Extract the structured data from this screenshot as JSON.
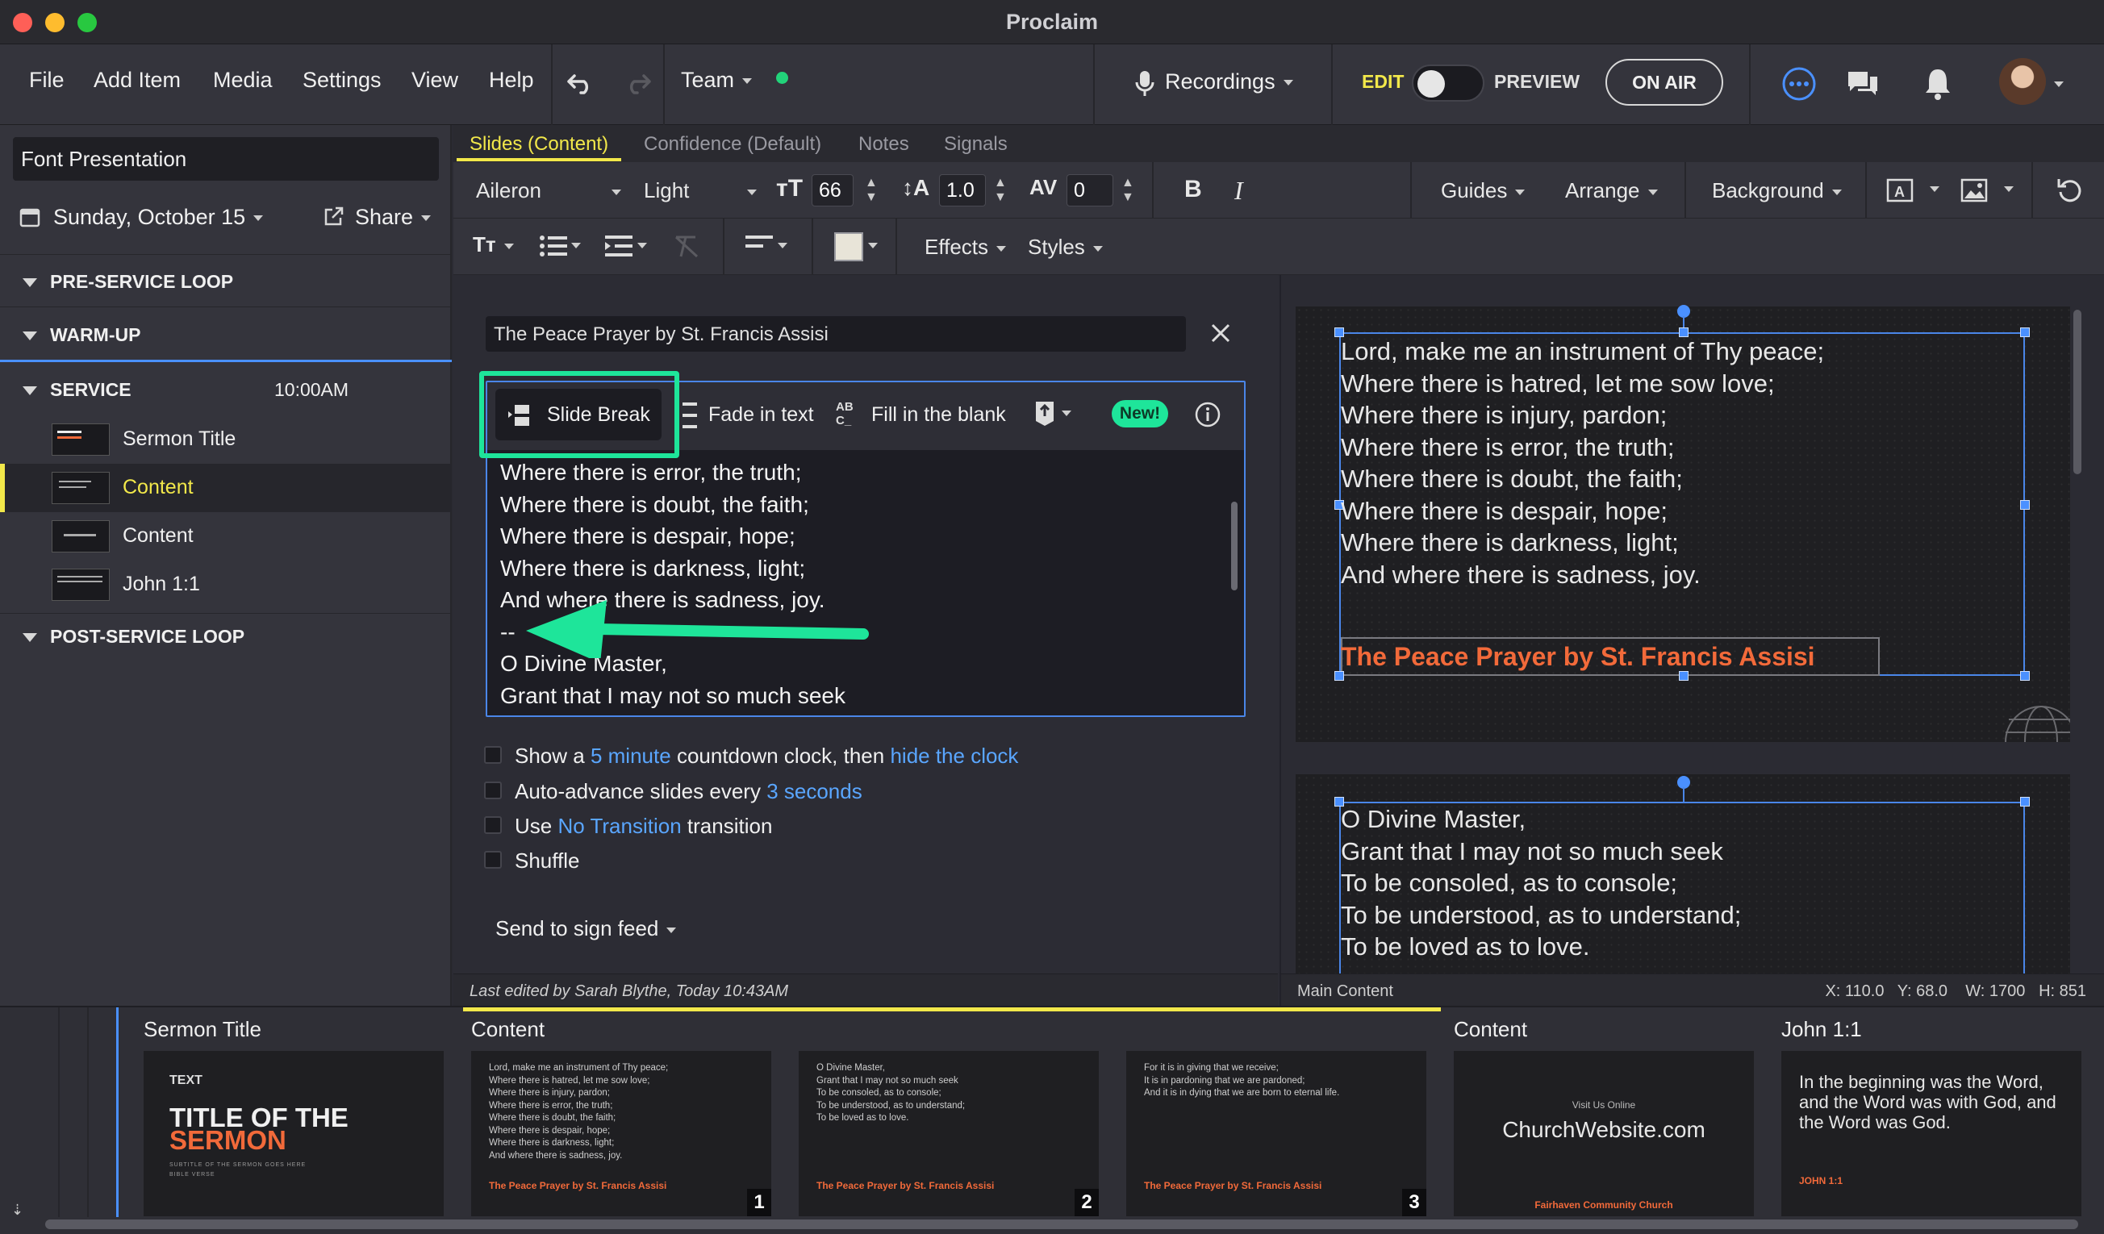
{
  "app": {
    "title": "Proclaim"
  },
  "menu": {
    "file": "File",
    "add_item": "Add Item",
    "media": "Media",
    "settings": "Settings",
    "view": "View",
    "help": "Help",
    "team": "Team",
    "recordings": "Recordings",
    "edit": "EDIT",
    "preview": "PREVIEW",
    "on_air": "ON AIR"
  },
  "sidebar": {
    "presentation": "Font Presentation",
    "date": "Sunday, October 15",
    "share": "Share",
    "sections": {
      "pre": "PRE-SERVICE LOOP",
      "warm": "WARM-UP",
      "service": "SERVICE",
      "service_time": "10:00AM",
      "post": "POST-SERVICE LOOP"
    },
    "items": [
      {
        "label": "Sermon Title"
      },
      {
        "label": "Content"
      },
      {
        "label": "Content"
      },
      {
        "label": "John 1:1"
      }
    ]
  },
  "tabs": {
    "slides": "Slides (Content)",
    "confidence": "Confidence (Default)",
    "notes": "Notes",
    "signals": "Signals"
  },
  "toolbar": {
    "font": "Aileron",
    "weight": "Light",
    "size": "66",
    "line_height": "1.0",
    "spacing": "0",
    "bold": "B",
    "italic": "I",
    "guides": "Guides",
    "arrange": "Arrange",
    "background": "Background",
    "effects": "Effects",
    "styles": "Styles",
    "accent_color": "#e8e4d8"
  },
  "editor": {
    "title_value": "The Peace Prayer by St. Francis Assisi",
    "slide_break": "Slide Break",
    "fade": "Fade in text",
    "fill": "Fill in the blank",
    "fill_icon": "AB C_",
    "new_badge": "New!",
    "lines": [
      "Where there is error, the truth;",
      "Where there is doubt, the faith;",
      "Where there is despair, hope;",
      "Where there is darkness, light;",
      "And where there is sadness, joy.",
      "--",
      "O Divine Master,",
      "Grant that I may not so much seek"
    ]
  },
  "options": {
    "o1_a": "Show a",
    "o1_link1": "5 minute",
    "o1_b": "countdown clock, then",
    "o1_link2": "hide the clock",
    "o2_a": "Auto-advance slides every",
    "o2_link": "3 seconds",
    "o3_a": "Use",
    "o3_link": "No Transition",
    "o3_b": "transition",
    "o4": "Shuffle",
    "send": "Send to sign feed"
  },
  "preview": {
    "slide1": [
      "Lord, make me an instrument of Thy peace;",
      "Where there is hatred, let me sow love;",
      "Where there is injury, pardon;",
      "Where there is error, the truth;",
      "Where there is doubt, the faith;",
      "Where there is despair, hope;",
      "Where there is darkness, light;",
      "And where there is sadness, joy."
    ],
    "slide1_title": "The Peace Prayer by St. Francis Assisi",
    "slide2": [
      "O Divine Master,",
      "Grant that I may not so much seek",
      "To be consoled, as to console;",
      "To be understood, as to understand;",
      "To be loved as to love."
    ]
  },
  "status": {
    "edited": "Last edited by Sarah Blythe, Today 10:43AM",
    "layer": "Main Content",
    "coords": "X: 110.0   Y: 68.0    W: 1700   H: 851"
  },
  "bottom": {
    "group1": "Sermon Title",
    "group2": "Content",
    "group3": "Content",
    "group4": "John 1:1",
    "sermon": {
      "small": "TEXT",
      "big1": "TITLE OF THE",
      "big2": "SERMON",
      "sub1": "SUBTITLE OF THE SERMON GOES HERE",
      "sub2": "BIBLE VERSE"
    },
    "c1": [
      "Lord, make me an instrument of Thy peace;",
      "Where there is hatred, let me sow love;",
      "Where there is injury, pardon;",
      "Where there is error, the truth;",
      "Where there is doubt, the faith;",
      "Where there is despair, hope;",
      "Where there is darkness, light;",
      "And where there is sadness, joy."
    ],
    "c2": [
      "O Divine Master,",
      "Grant that I may not so much seek",
      "To be consoled, as to console;",
      "To be understood, as to understand;",
      "To be loved as to love."
    ],
    "c3": [
      "For it is in giving that we receive;",
      "It is in pardoning that we are pardoned;",
      "And it is in dying that we are born to eternal life."
    ],
    "ctitle": "The Peace Prayer by St. Francis Assisi",
    "n1": "1",
    "n2": "2",
    "n3": "3",
    "web_small": "Visit Us Online",
    "web": "ChurchWebsite.com",
    "church": "Fairhaven Community Church",
    "john": "In the beginning was the Word, and the Word was with God, and the Word was God.",
    "john_ref": "JOHN 1:1"
  },
  "colors": {
    "accent_yellow": "#f2e84a",
    "highlight_green": "#1ee59a",
    "orange": "#f26a3a",
    "link": "#5aa6ff"
  }
}
